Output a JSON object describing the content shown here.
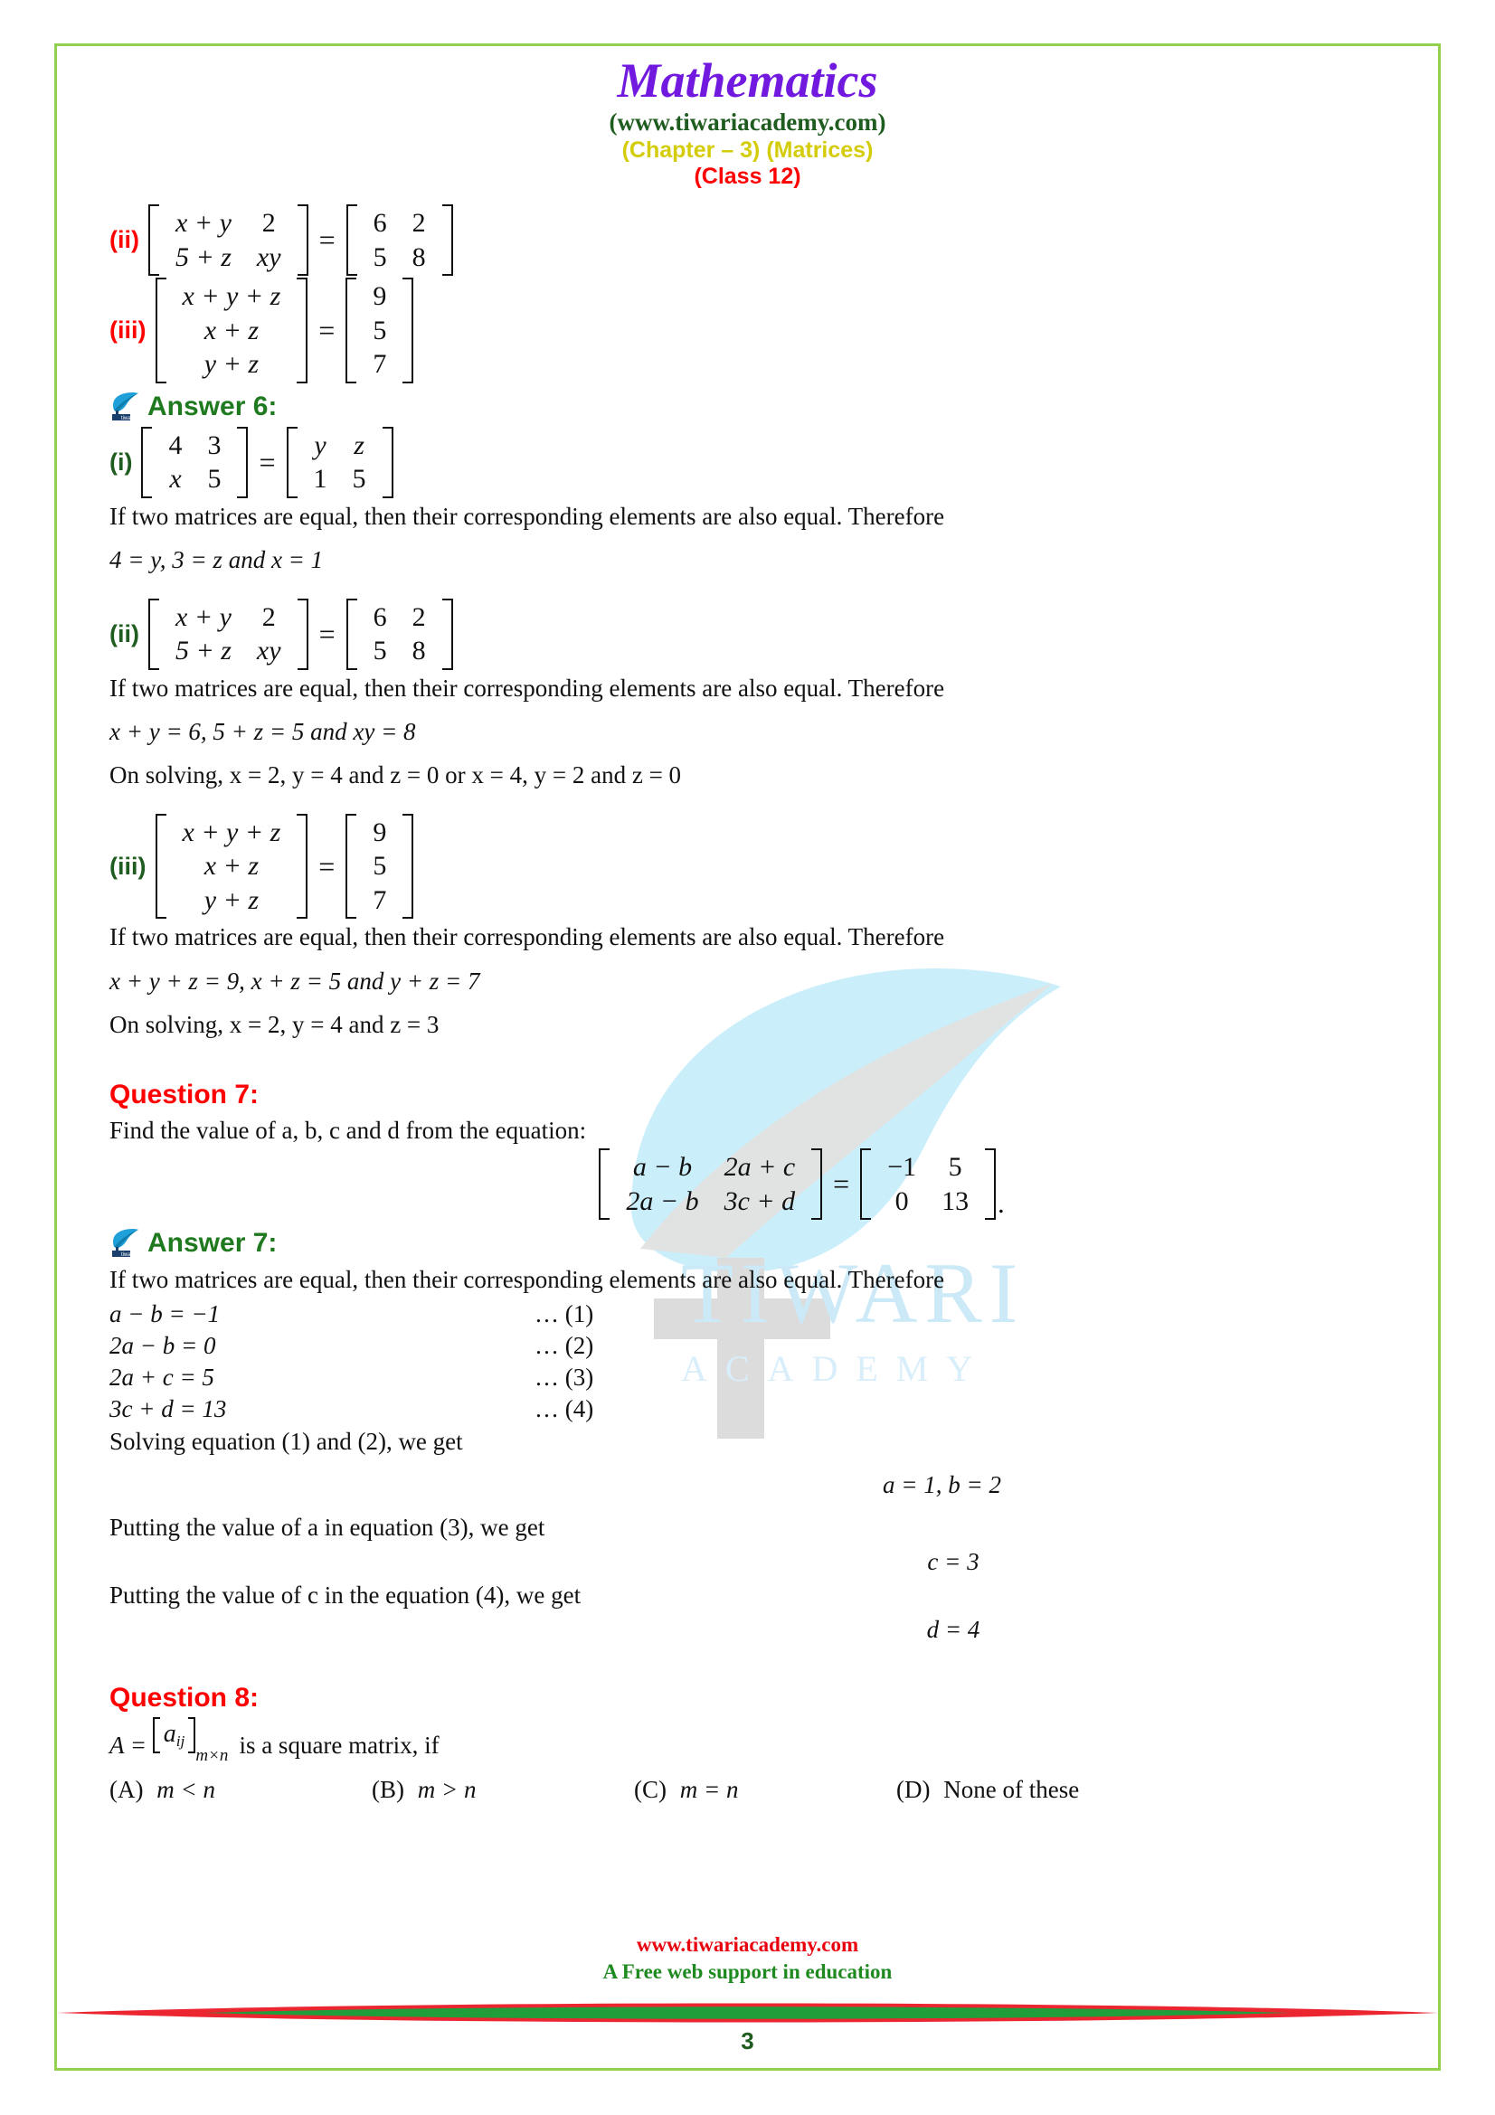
{
  "page": {
    "border_color": "#92d050",
    "page_number": "3"
  },
  "header": {
    "title": "Mathematics",
    "site": "(www.tiwariacademy.com)",
    "chapter": "(Chapter – 3) (Matrices)",
    "class": "(Class 12)",
    "title_color": "#7219e0",
    "site_color": "#1f5c1f",
    "chapter_color": "#d4cc09",
    "class_color": "#ff0000"
  },
  "watermark": {
    "brand": "TIWARI",
    "sub": "ACADEMY",
    "color": "#cbe9f7"
  },
  "question6_parts": {
    "part_ii_label": "(ii)",
    "part_ii_left": [
      [
        "x + y",
        "2"
      ],
      [
        "5 + z",
        "xy"
      ]
    ],
    "part_ii_right": [
      [
        "6",
        "2"
      ],
      [
        "5",
        "8"
      ]
    ],
    "part_iii_label": "(iii)",
    "part_iii_left": [
      [
        "x + y + z"
      ],
      [
        "x + z"
      ],
      [
        "y + z"
      ]
    ],
    "part_iii_right": [
      [
        "9"
      ],
      [
        "5"
      ],
      [
        "7"
      ]
    ],
    "equals": "="
  },
  "answer6": {
    "heading": "Answer 6:",
    "part_i": {
      "label": "(i)",
      "left": [
        [
          "4",
          "3"
        ],
        [
          "x",
          "5"
        ]
      ],
      "right": [
        [
          "y",
          "z"
        ],
        [
          "1",
          "5"
        ]
      ],
      "statement": "If two matrices are equal, then their corresponding elements are also equal. Therefore",
      "result": "4 = y,        3 = z  and  x = 1"
    },
    "part_ii": {
      "label": "(ii)",
      "left": [
        [
          "x + y",
          "2"
        ],
        [
          "5 + z",
          "xy"
        ]
      ],
      "right": [
        [
          "6",
          "2"
        ],
        [
          "5",
          "8"
        ]
      ],
      "statement": "If two matrices are equal, then their corresponding elements are also equal. Therefore",
      "result": "x + y = 6,        5 + z = 5  and   xy = 8",
      "solving": "On solving, x = 2, y = 4  and z = 0   or  x = 4, y = 2  and z = 0"
    },
    "part_iii": {
      "label": "(iii)",
      "left": [
        [
          "x + y + z"
        ],
        [
          "x + z"
        ],
        [
          "y + z"
        ]
      ],
      "right": [
        [
          "9"
        ],
        [
          "5"
        ],
        [
          "7"
        ]
      ],
      "statement": "If two matrices are equal, then their corresponding elements are also equal. Therefore",
      "result": "x + y + z = 9,        x + z = 5  and   y + z = 7",
      "solving": "On solving, x = 2,  y = 4  and z = 3"
    }
  },
  "question7": {
    "heading": "Question 7:",
    "prompt": "Find the value of a, b, c and d from the equation:",
    "matrix_left": [
      [
        "a − b",
        "2a + c"
      ],
      [
        "2a − b",
        "3c + d"
      ]
    ],
    "matrix_right": [
      [
        "−1",
        "5"
      ],
      [
        "0",
        "13"
      ]
    ],
    "equals": "=",
    "period": "."
  },
  "answer7": {
    "heading": "Answer 7:",
    "statement": "If two matrices are equal, then their corresponding elements are also equal. Therefore",
    "equations": [
      {
        "eq": "a − b =  −1",
        "ref": "… (1)"
      },
      {
        "eq": "2a − b =  0",
        "ref": "… (2)"
      },
      {
        "eq": "2a + c =  5",
        "ref": "… (3)"
      },
      {
        "eq": "3c + d =  13",
        "ref": "… (4)"
      }
    ],
    "step1": "Solving equation (1) and (2), we get",
    "value_ab": "a = 1,        b = 2",
    "step2": "Putting the value of a in equation (3), we get",
    "value_c": "c = 3",
    "step3": "Putting the value of c in the equation (4), we get",
    "value_d": "d = 4"
  },
  "question8": {
    "heading": "Question 8:",
    "stem_a": "A",
    "stem_eq": "=",
    "stem_bracket_open": "[",
    "stem_aij": "a",
    "stem_aij_sub": "ij",
    "stem_bracket_close": "]",
    "stem_mxn": "m×n",
    "stem_tail": "is a square matrix, if",
    "options": [
      {
        "label": "(A)",
        "text": "m < n"
      },
      {
        "label": "(B)",
        "text": "m > n"
      },
      {
        "label": "(C)",
        "text": "m = n"
      },
      {
        "label": "(D)",
        "text": "None of these"
      }
    ]
  },
  "footer": {
    "site": "www.tiwariacademy.com",
    "tagline": "A Free web support in education",
    "page_number": "3",
    "site_color": "#e8000d",
    "tagline_color": "#1f8a20"
  }
}
